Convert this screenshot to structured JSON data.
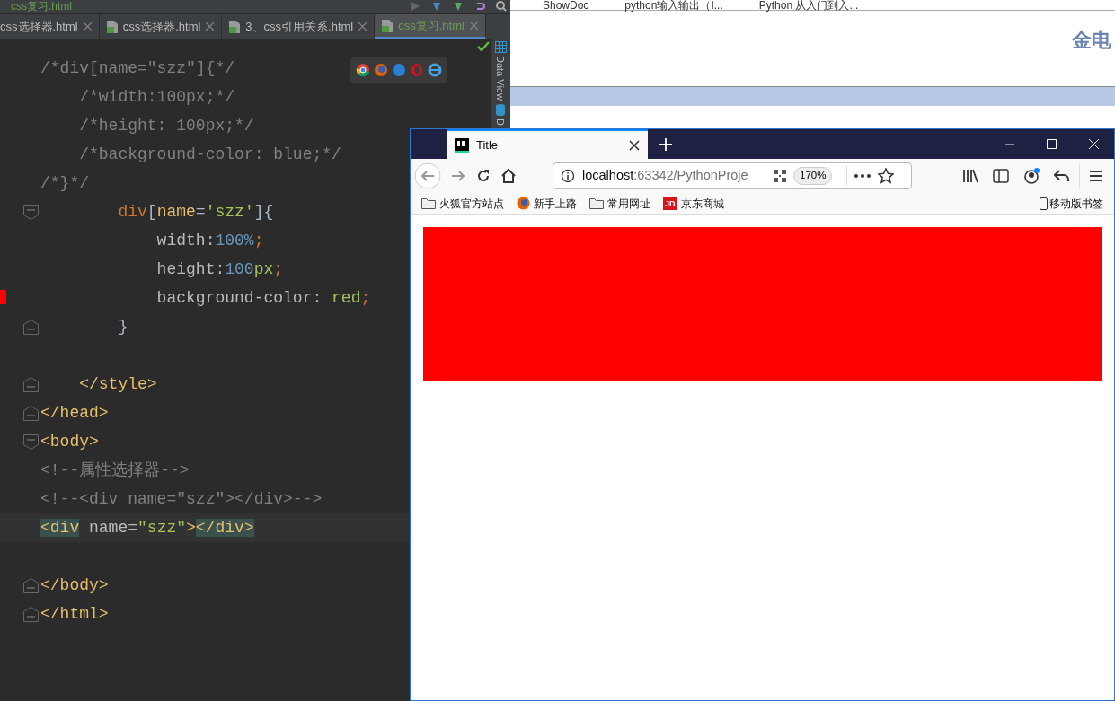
{
  "background_browser": {
    "bookmarks": [
      "ShowDoc",
      "python输入输出（I...",
      "Python 从入门到入..."
    ],
    "heading": "金电"
  },
  "ide": {
    "breadcrumb": "css复习.html",
    "tabs": [
      {
        "label": "css选择器.html",
        "selected": false
      },
      {
        "label": "css选择器.html",
        "selected": false
      },
      {
        "label": "3、css引用关系.html",
        "selected": false
      },
      {
        "label": "css复习.html",
        "selected": true
      }
    ],
    "side_panel": [
      "Data View",
      "D"
    ],
    "code_lines": [
      {
        "kind": "text",
        "tokens": [
          {
            "kind": "comment",
            "text": "/*div[name=\"szz\"]{*/"
          }
        ]
      },
      {
        "kind": "text",
        "tokens": [
          {
            "kind": "comment",
            "text": "    /*width:100px;*/"
          }
        ]
      },
      {
        "kind": "text",
        "tokens": [
          {
            "kind": "comment",
            "text": "    /*height: 100px;*/"
          }
        ]
      },
      {
        "kind": "text",
        "tokens": [
          {
            "kind": "comment",
            "text": "    /*background-color: blue;*/"
          }
        ]
      },
      {
        "kind": "text",
        "tokens": [
          {
            "kind": "comment",
            "text": "/*}*/"
          }
        ]
      },
      {
        "kind": "fold_start",
        "tokens": [
          {
            "kind": "selector",
            "text": "        div"
          },
          {
            "kind": "plain",
            "text": "["
          },
          {
            "kind": "tag",
            "text": "name"
          },
          {
            "kind": "plain",
            "text": "="
          },
          {
            "kind": "string",
            "text": "'szz'"
          },
          {
            "kind": "plain",
            "text": "]{"
          }
        ]
      },
      {
        "kind": "text",
        "tokens": [
          {
            "kind": "property",
            "text": "            width:"
          },
          {
            "kind": "number",
            "text": "100%"
          },
          {
            "kind": "punct",
            "text": ";"
          }
        ]
      },
      {
        "kind": "text",
        "tokens": [
          {
            "kind": "property",
            "text": "            height:"
          },
          {
            "kind": "number",
            "text": "100"
          },
          {
            "kind": "string",
            "text": "px"
          },
          {
            "kind": "punct",
            "text": ";"
          }
        ]
      },
      {
        "kind": "text",
        "marked": true,
        "tokens": [
          {
            "kind": "property",
            "text": "            background-color: "
          },
          {
            "kind": "string",
            "text": "red"
          },
          {
            "kind": "punct",
            "text": ";"
          }
        ]
      },
      {
        "kind": "fold_end",
        "tokens": [
          {
            "kind": "plain",
            "text": "        }"
          }
        ]
      },
      {
        "kind": "blank"
      },
      {
        "kind": "fold_end",
        "tokens": [
          {
            "kind": "tag",
            "text": "    </style>"
          }
        ]
      },
      {
        "kind": "fold_end",
        "tokens": [
          {
            "kind": "tag",
            "text": "</head>"
          }
        ]
      },
      {
        "kind": "fold_start",
        "tokens": [
          {
            "kind": "tag",
            "text": "<body>"
          }
        ]
      },
      {
        "kind": "text",
        "tokens": [
          {
            "kind": "comment",
            "text": "<!--属性选择器-->"
          }
        ]
      },
      {
        "kind": "text",
        "tokens": [
          {
            "kind": "comment",
            "text": "<!--<div name=\"szz\"></div>-->"
          }
        ]
      },
      {
        "kind": "text",
        "current": true,
        "tokens": [
          {
            "kind": "tag_match",
            "text": "<div"
          },
          {
            "kind": "attr",
            "text": " name="
          },
          {
            "kind": "string",
            "text": "\"szz\""
          },
          {
            "kind": "tag",
            "text": ">"
          },
          {
            "kind": "tag_match",
            "text": "</div>"
          }
        ]
      },
      {
        "kind": "blank"
      },
      {
        "kind": "fold_end",
        "tokens": [
          {
            "kind": "tag",
            "text": "</body>"
          }
        ]
      },
      {
        "kind": "fold_end",
        "tokens": [
          {
            "kind": "tag",
            "text": "</html>"
          }
        ]
      }
    ]
  },
  "browser": {
    "tab_title": "Title",
    "url_host": "localhost",
    "url_rest": ":63342/PythonProje",
    "zoom": "170%",
    "bookmarks": [
      {
        "kind": "folder",
        "label": "火狐官方站点"
      },
      {
        "kind": "firefox",
        "label": "新手上路"
      },
      {
        "kind": "folder",
        "label": "常用网址"
      },
      {
        "kind": "jd",
        "icon_text": "JD",
        "label": "京东商城"
      }
    ],
    "mobile_bookmarks": "移动版书签"
  }
}
